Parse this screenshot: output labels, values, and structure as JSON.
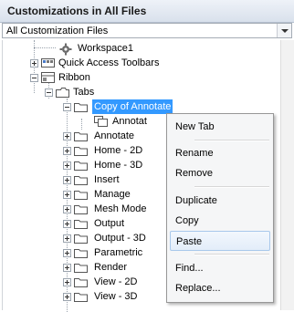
{
  "panel": {
    "title": "Customizations in All Files",
    "filter_value": "All Customization Files"
  },
  "tree": [
    {
      "label": "Workspace1",
      "icon": "workspace-gear-icon"
    },
    {
      "label": "Quick Access Toolbars",
      "icon": "toolbar-icon"
    },
    {
      "label": "Ribbon",
      "icon": "ribbon-icon"
    },
    {
      "label": "Tabs",
      "icon": "tabs-icon"
    },
    {
      "label": "Copy of Annotate",
      "icon": "folder-icon",
      "selected": true
    },
    {
      "label": "Annotat",
      "icon": "panel-icon"
    },
    {
      "label": "Annotate",
      "icon": "folder-icon"
    },
    {
      "label": "Home - 2D",
      "icon": "folder-icon"
    },
    {
      "label": "Home - 3D",
      "icon": "folder-icon"
    },
    {
      "label": "Insert",
      "icon": "folder-icon"
    },
    {
      "label": "Manage",
      "icon": "folder-icon"
    },
    {
      "label": "Mesh Mode",
      "icon": "folder-icon"
    },
    {
      "label": "Output",
      "icon": "folder-icon"
    },
    {
      "label": "Output - 3D",
      "icon": "folder-icon"
    },
    {
      "label": "Parametric",
      "icon": "folder-icon"
    },
    {
      "label": "Render",
      "icon": "folder-icon"
    },
    {
      "label": "View - 2D",
      "icon": "folder-icon"
    },
    {
      "label": "View - 3D",
      "icon": "folder-icon"
    }
  ],
  "context_menu": {
    "items": [
      "New Tab",
      "Rename",
      "Remove",
      "Duplicate",
      "Copy",
      "Paste",
      "Find...",
      "Replace..."
    ],
    "highlighted": "Paste"
  }
}
